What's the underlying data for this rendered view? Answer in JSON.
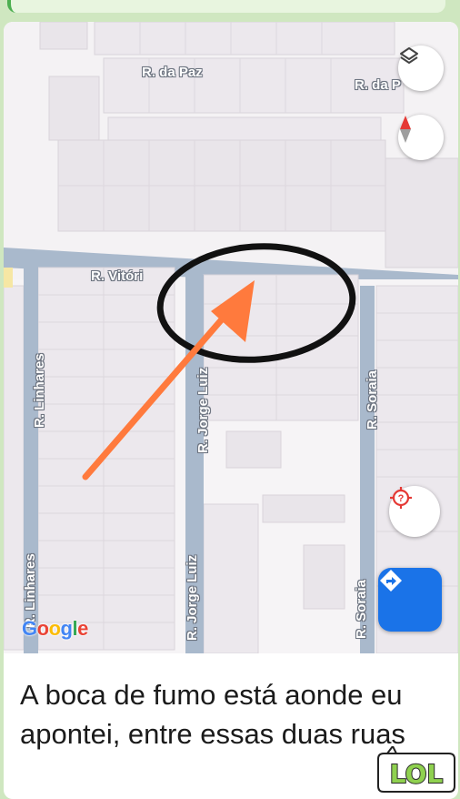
{
  "message": {
    "caption": "A boca de fumo está aonde eu apontei, entre essas duas ruas"
  },
  "map": {
    "streets": {
      "da_paz_1": "R. da Paz",
      "da_paz_2": "R. da P",
      "vitoria": "R. Vitóri",
      "linhares_1": "R. Linhares",
      "linhares_2": "R. Linhares",
      "jorge_luiz_1": "R. Jorge Luiz",
      "jorge_luiz_2": "R. Jorge Luiz",
      "soraia_1": "R. Soraia",
      "soraia_2": "R. Soraia"
    },
    "attribution": [
      "G",
      "o",
      "o",
      "g",
      "l",
      "e"
    ],
    "attribution_colors": [
      "#4285f4",
      "#ea4335",
      "#fbbc05",
      "#4285f4",
      "#34a853",
      "#ea4335"
    ],
    "controls": {
      "layers_icon": "layers-icon",
      "compass_icon": "compass-icon",
      "location_icon": "my-location-icon",
      "directions_icon": "directions-icon"
    }
  },
  "annotations": {
    "circle_color": "#111111",
    "arrow_color": "#ff7a3d"
  },
  "sticker": {
    "text": "LOL"
  }
}
